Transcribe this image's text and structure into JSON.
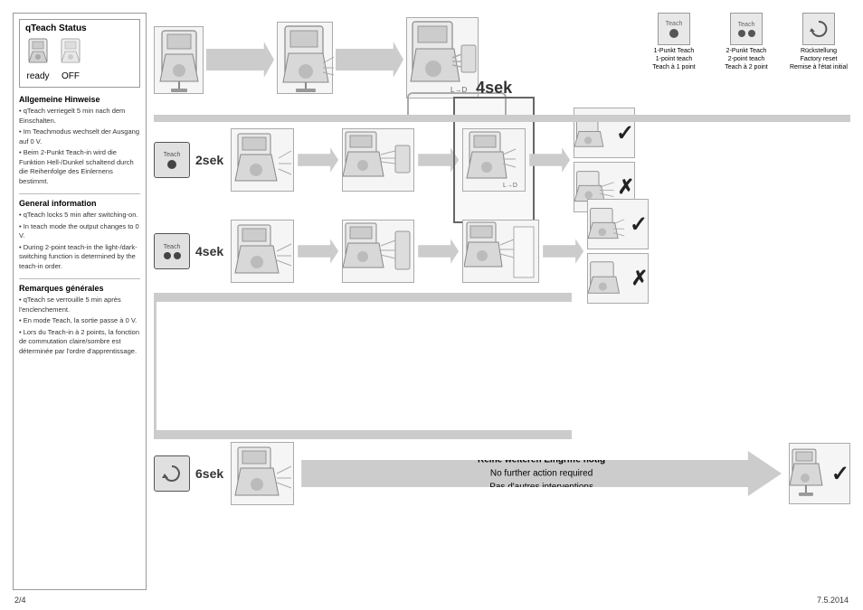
{
  "page": {
    "page_number": "2/4",
    "date": "7.5.2014"
  },
  "status_box": {
    "title": "qTeach Status",
    "items": [
      {
        "label": "ready"
      },
      {
        "label": "OFF"
      }
    ]
  },
  "info_sections": [
    {
      "id": "german",
      "title": "Allgemeine Hinweise",
      "bullets": [
        "qTeach verriegelt 5 min nach dem Einschalten.",
        "Im Teachmodus wechselt der Ausgang auf 0 V.",
        "Beim 2-Punkt Teach-in wird die Funktion Hell-/Dunkel schaltend durch die Reihenfolge des Einlernens bestimmt."
      ]
    },
    {
      "id": "english",
      "title": "General information",
      "bullets": [
        "qTeach locks 5 min after switching-on.",
        "In teach mode the output changes to 0 V.",
        "During 2-point teach-in the light-/dark-switching function is determined by the teach-in order."
      ]
    },
    {
      "id": "french",
      "title": "Remarques générales",
      "bullets": [
        "qTeach se verrouille 5 min après l'enclenchement.",
        "En mode Teach, la sortie passe à 0 V.",
        "Lors du Teach-in à 2 points, la fonction de commutation claire/sombre est déterminée par l'ordre d'apprentissage."
      ]
    }
  ],
  "legend": [
    {
      "id": "1punkt",
      "label_de": "1-Punkt Teach",
      "label_en": "1-point teach",
      "label_fr": "Teach à 1 point",
      "dots": 1
    },
    {
      "id": "2punkt",
      "label_de": "2-Punkt Teach",
      "label_en": "2-point teach",
      "label_fr": "Teach à 2 point",
      "dots": 2
    },
    {
      "id": "reset",
      "label_de": "Rückstellung",
      "label_en": "Factory reset",
      "label_fr": "Remise à l'état initial",
      "dots": 0
    }
  ],
  "flow_rows": [
    {
      "id": "row1",
      "teach_time": "2sek",
      "teach_dots": 1
    },
    {
      "id": "row2",
      "teach_time": "4sek",
      "teach_dots": 2
    },
    {
      "id": "row3",
      "teach_time": "6sek",
      "teach_dots": 0
    }
  ],
  "highlight_4sek": "4sek",
  "bottom_banner": {
    "text_de": "Keine weiteren Eingriffe nötig",
    "text_en": "No further action required",
    "text_fr": "Pas d'autres interventions"
  }
}
